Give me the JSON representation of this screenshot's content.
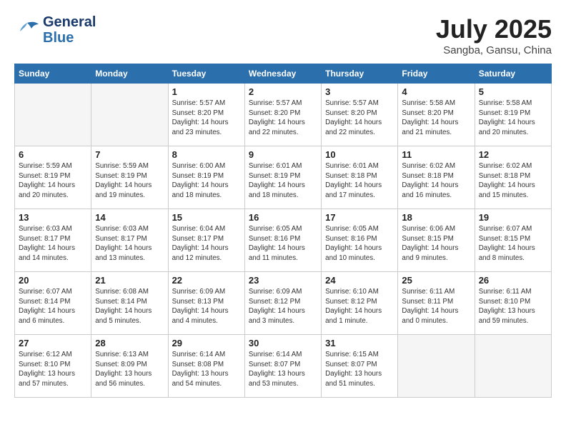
{
  "header": {
    "logo_general": "General",
    "logo_blue": "Blue",
    "month_year": "July 2025",
    "location": "Sangba, Gansu, China"
  },
  "weekdays": [
    "Sunday",
    "Monday",
    "Tuesday",
    "Wednesday",
    "Thursday",
    "Friday",
    "Saturday"
  ],
  "weeks": [
    [
      {
        "day": "",
        "info": ""
      },
      {
        "day": "",
        "info": ""
      },
      {
        "day": "1",
        "info": "Sunrise: 5:57 AM\nSunset: 8:20 PM\nDaylight: 14 hours and 23 minutes."
      },
      {
        "day": "2",
        "info": "Sunrise: 5:57 AM\nSunset: 8:20 PM\nDaylight: 14 hours and 22 minutes."
      },
      {
        "day": "3",
        "info": "Sunrise: 5:57 AM\nSunset: 8:20 PM\nDaylight: 14 hours and 22 minutes."
      },
      {
        "day": "4",
        "info": "Sunrise: 5:58 AM\nSunset: 8:20 PM\nDaylight: 14 hours and 21 minutes."
      },
      {
        "day": "5",
        "info": "Sunrise: 5:58 AM\nSunset: 8:19 PM\nDaylight: 14 hours and 20 minutes."
      }
    ],
    [
      {
        "day": "6",
        "info": "Sunrise: 5:59 AM\nSunset: 8:19 PM\nDaylight: 14 hours and 20 minutes."
      },
      {
        "day": "7",
        "info": "Sunrise: 5:59 AM\nSunset: 8:19 PM\nDaylight: 14 hours and 19 minutes."
      },
      {
        "day": "8",
        "info": "Sunrise: 6:00 AM\nSunset: 8:19 PM\nDaylight: 14 hours and 18 minutes."
      },
      {
        "day": "9",
        "info": "Sunrise: 6:01 AM\nSunset: 8:19 PM\nDaylight: 14 hours and 18 minutes."
      },
      {
        "day": "10",
        "info": "Sunrise: 6:01 AM\nSunset: 8:18 PM\nDaylight: 14 hours and 17 minutes."
      },
      {
        "day": "11",
        "info": "Sunrise: 6:02 AM\nSunset: 8:18 PM\nDaylight: 14 hours and 16 minutes."
      },
      {
        "day": "12",
        "info": "Sunrise: 6:02 AM\nSunset: 8:18 PM\nDaylight: 14 hours and 15 minutes."
      }
    ],
    [
      {
        "day": "13",
        "info": "Sunrise: 6:03 AM\nSunset: 8:17 PM\nDaylight: 14 hours and 14 minutes."
      },
      {
        "day": "14",
        "info": "Sunrise: 6:03 AM\nSunset: 8:17 PM\nDaylight: 14 hours and 13 minutes."
      },
      {
        "day": "15",
        "info": "Sunrise: 6:04 AM\nSunset: 8:17 PM\nDaylight: 14 hours and 12 minutes."
      },
      {
        "day": "16",
        "info": "Sunrise: 6:05 AM\nSunset: 8:16 PM\nDaylight: 14 hours and 11 minutes."
      },
      {
        "day": "17",
        "info": "Sunrise: 6:05 AM\nSunset: 8:16 PM\nDaylight: 14 hours and 10 minutes."
      },
      {
        "day": "18",
        "info": "Sunrise: 6:06 AM\nSunset: 8:15 PM\nDaylight: 14 hours and 9 minutes."
      },
      {
        "day": "19",
        "info": "Sunrise: 6:07 AM\nSunset: 8:15 PM\nDaylight: 14 hours and 8 minutes."
      }
    ],
    [
      {
        "day": "20",
        "info": "Sunrise: 6:07 AM\nSunset: 8:14 PM\nDaylight: 14 hours and 6 minutes."
      },
      {
        "day": "21",
        "info": "Sunrise: 6:08 AM\nSunset: 8:14 PM\nDaylight: 14 hours and 5 minutes."
      },
      {
        "day": "22",
        "info": "Sunrise: 6:09 AM\nSunset: 8:13 PM\nDaylight: 14 hours and 4 minutes."
      },
      {
        "day": "23",
        "info": "Sunrise: 6:09 AM\nSunset: 8:12 PM\nDaylight: 14 hours and 3 minutes."
      },
      {
        "day": "24",
        "info": "Sunrise: 6:10 AM\nSunset: 8:12 PM\nDaylight: 14 hours and 1 minute."
      },
      {
        "day": "25",
        "info": "Sunrise: 6:11 AM\nSunset: 8:11 PM\nDaylight: 14 hours and 0 minutes."
      },
      {
        "day": "26",
        "info": "Sunrise: 6:11 AM\nSunset: 8:10 PM\nDaylight: 13 hours and 59 minutes."
      }
    ],
    [
      {
        "day": "27",
        "info": "Sunrise: 6:12 AM\nSunset: 8:10 PM\nDaylight: 13 hours and 57 minutes."
      },
      {
        "day": "28",
        "info": "Sunrise: 6:13 AM\nSunset: 8:09 PM\nDaylight: 13 hours and 56 minutes."
      },
      {
        "day": "29",
        "info": "Sunrise: 6:14 AM\nSunset: 8:08 PM\nDaylight: 13 hours and 54 minutes."
      },
      {
        "day": "30",
        "info": "Sunrise: 6:14 AM\nSunset: 8:07 PM\nDaylight: 13 hours and 53 minutes."
      },
      {
        "day": "31",
        "info": "Sunrise: 6:15 AM\nSunset: 8:07 PM\nDaylight: 13 hours and 51 minutes."
      },
      {
        "day": "",
        "info": ""
      },
      {
        "day": "",
        "info": ""
      }
    ]
  ]
}
